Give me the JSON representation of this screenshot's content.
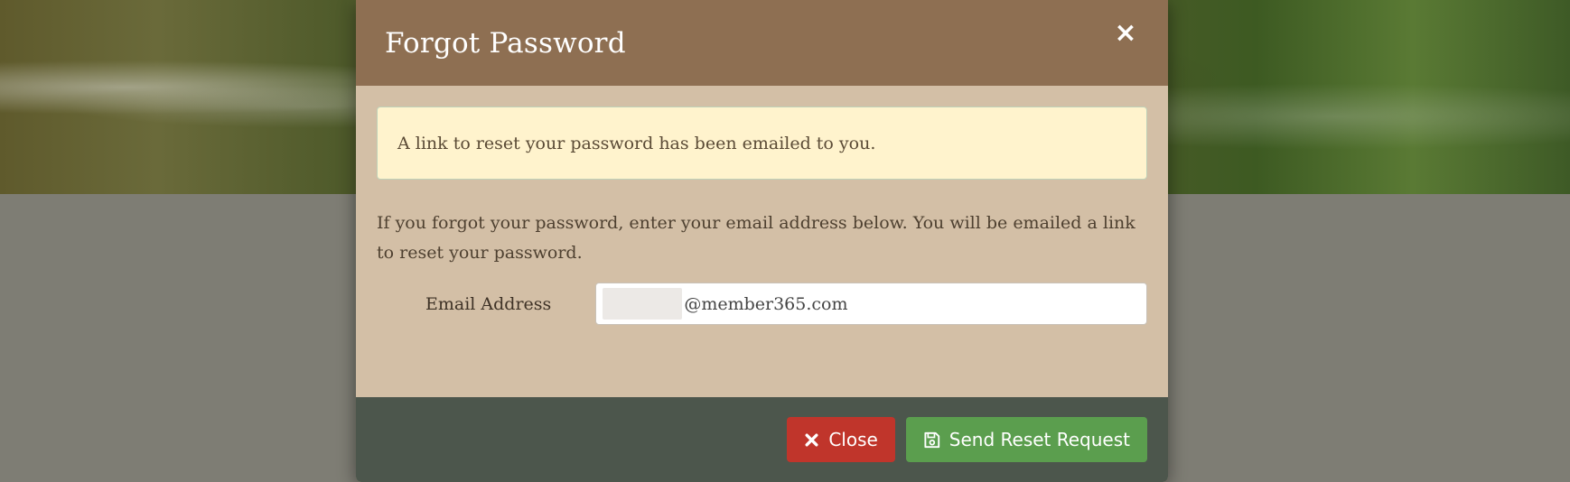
{
  "modal": {
    "title": "Forgot Password",
    "close_icon": "times-icon",
    "alert_message": "A link to reset your password has been emailed to you.",
    "intro_text": "If you forgot your password, enter your email address below. You will be emailed a link to reset your password.",
    "email_label": "Email Address",
    "email_value": "@member365.com"
  },
  "footer": {
    "close_label": "Close",
    "close_icon": "times-icon",
    "send_label": "Send Reset Request",
    "send_icon": "save-icon"
  },
  "colors": {
    "header": "#8e6f52",
    "body": "#d3bfa6",
    "footer": "#4c564c",
    "alert_bg": "#fff3cd",
    "close_button": "#c0352b",
    "send_button": "#5b9e4e"
  }
}
